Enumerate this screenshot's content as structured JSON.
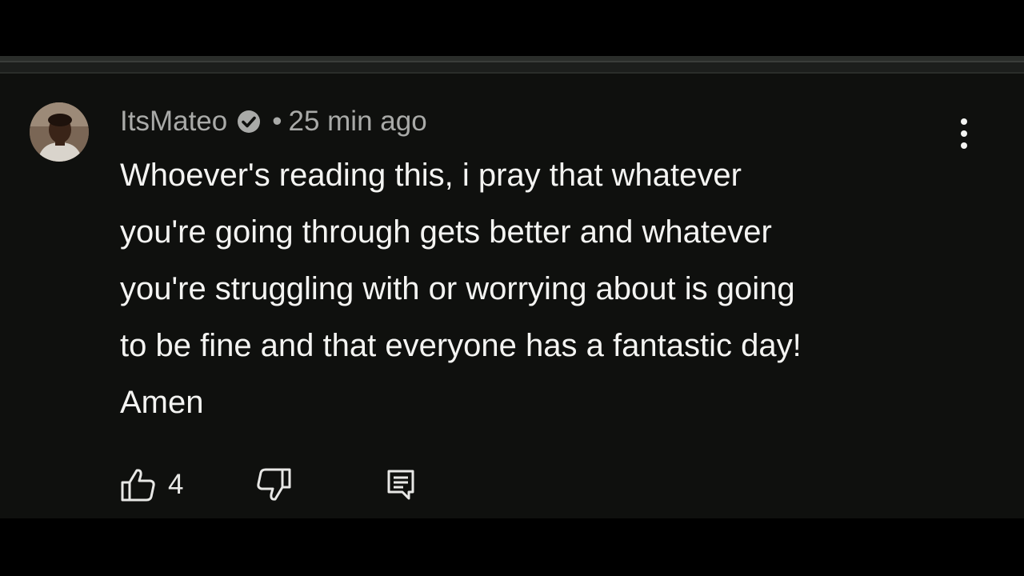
{
  "comment": {
    "author": "ItsMateo",
    "separator": "•",
    "timestamp": "25 min ago",
    "text": "Whoever's reading this, i pray that whatever\nyou're going through gets better and whatever\nyou're struggling with or worrying about is going\nto be fine and that everyone has a fantastic day!\nAmen",
    "like_count": "4"
  },
  "icons": {
    "avatar": "avatar",
    "verified": "verified-check-icon",
    "more": "more-vertical-icon",
    "like": "thumbs-up-icon",
    "dislike": "thumbs-down-icon",
    "reply": "reply-comment-icon"
  },
  "colors": {
    "background": "#000000",
    "panel": "#0f100e",
    "text_primary": "#f4f4f2",
    "text_secondary": "#a9aaa8"
  }
}
